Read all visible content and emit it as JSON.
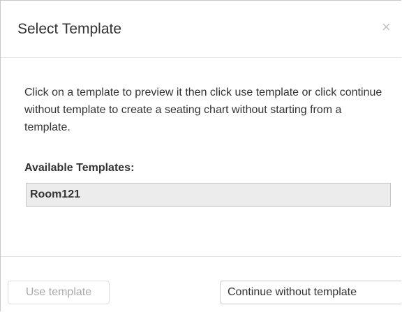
{
  "dialog": {
    "title": "Select Template",
    "close_label": "×"
  },
  "body": {
    "instructions": "Click on a template to preview it then click use template or click continue without template to create a seating chart without starting from a template.",
    "templates_label": "Available Templates:",
    "templates": [
      {
        "name": "Room121",
        "selected": true
      }
    ]
  },
  "footer": {
    "use_template_label": "Use template",
    "use_template_enabled": false,
    "continue_label": "Continue without template"
  }
}
